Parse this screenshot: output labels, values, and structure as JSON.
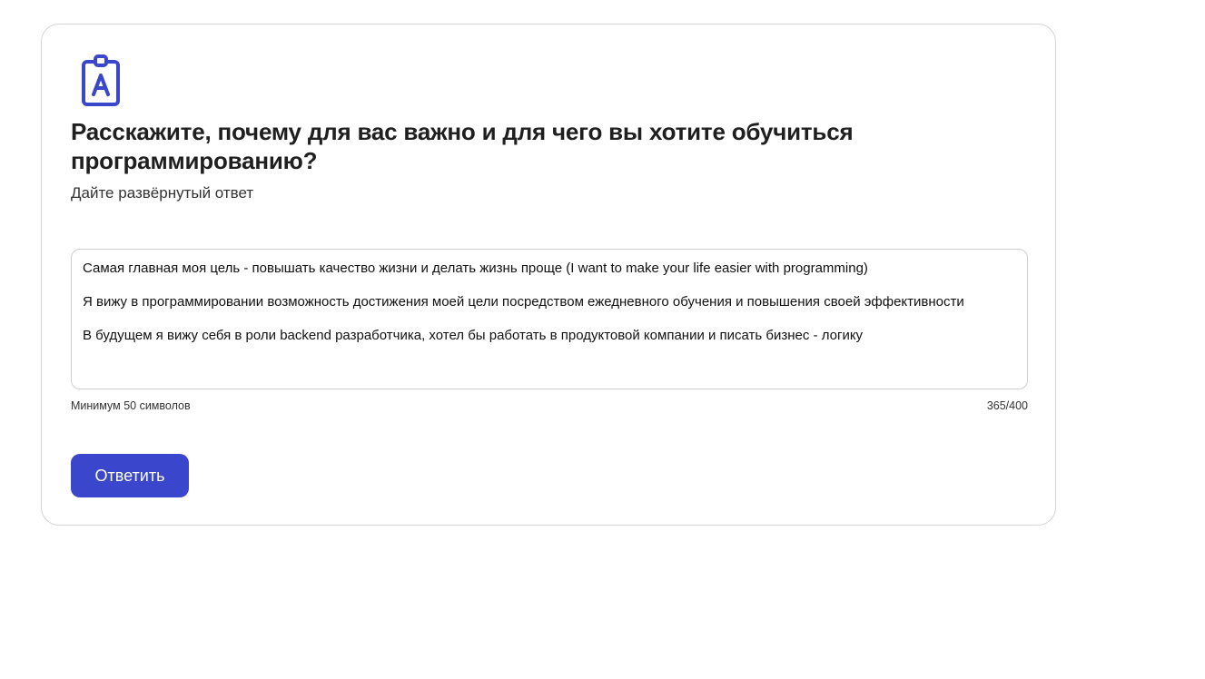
{
  "question": {
    "icon": "clipboard-a-icon",
    "title": "Расскажите, почему для вас важно и для чего вы хотите обучиться программированию?",
    "hint": "Дайте развёрнутый ответ"
  },
  "answer": {
    "lines": [
      "Самая главная моя цель - повышать качество жизни и делать жизнь проще (I want to make your life easier with programming)",
      "Я вижу в программировании возможность достижения моей цели посредством ежедневного обучения и повышения своей эффективности",
      "В будущем я вижу себя в роли backend разработчика, хотел бы работать в продуктовой компании и писать бизнес - логику"
    ],
    "min_hint": "Минимум 50 символов",
    "counter": "365/400"
  },
  "actions": {
    "submit_label": "Ответить"
  },
  "colors": {
    "accent": "#3a47cc",
    "icon": "#3a47cc",
    "border": "#d4d4d4"
  }
}
